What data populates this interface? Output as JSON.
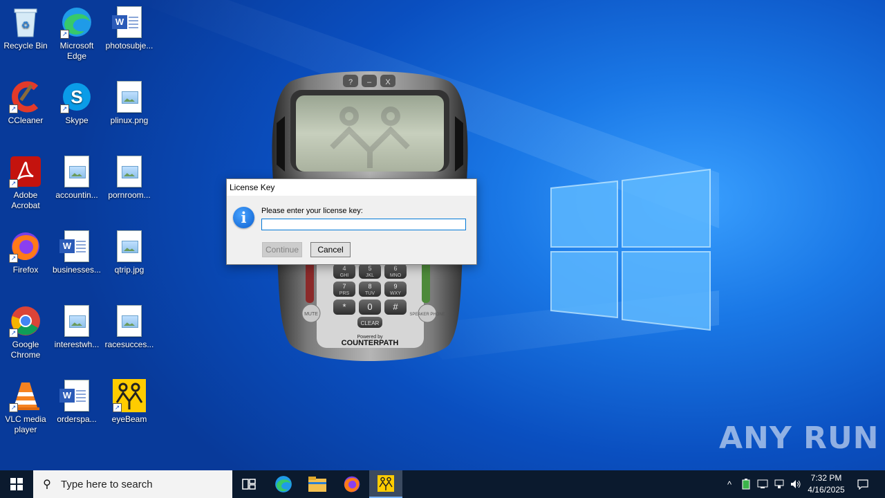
{
  "desktop": {
    "icons": [
      {
        "label": "Recycle Bin"
      },
      {
        "label": "Microsoft Edge"
      },
      {
        "label": "photosubje..."
      },
      {
        "label": "CCleaner"
      },
      {
        "label": "Skype"
      },
      {
        "label": "plinux.png"
      },
      {
        "label": "Adobe Acrobat"
      },
      {
        "label": "accountin..."
      },
      {
        "label": "pornroom..."
      },
      {
        "label": "Firefox"
      },
      {
        "label": "businesses..."
      },
      {
        "label": "qtrip.jpg"
      },
      {
        "label": "Google Chrome"
      },
      {
        "label": "interestwh..."
      },
      {
        "label": "racesucces..."
      },
      {
        "label": "VLC media player"
      },
      {
        "label": "orderspa..."
      },
      {
        "label": "eyeBeam"
      }
    ]
  },
  "phone": {
    "keys": [
      {
        "num": "4",
        "letters": "GHI"
      },
      {
        "num": "5",
        "letters": "JKL"
      },
      {
        "num": "6",
        "letters": "MNO"
      },
      {
        "num": "7",
        "letters": "PRS"
      },
      {
        "num": "8",
        "letters": "TUV"
      },
      {
        "num": "9",
        "letters": "WXY"
      },
      {
        "num": "*",
        "letters": ""
      },
      {
        "num": "0",
        "letters": ""
      },
      {
        "num": "#",
        "letters": ""
      }
    ],
    "clear_label": "CLEAR",
    "mute_label": "MUTE",
    "speaker_label": "SPEAKER PHONE",
    "powered_by": "Powered by",
    "brand": "COUNTERPATH",
    "top_buttons": [
      "?",
      "–",
      "X"
    ]
  },
  "dialog": {
    "title": "License Key",
    "prompt": "Please enter your license key:",
    "input_value": "",
    "continue_label": "Continue",
    "cancel_label": "Cancel"
  },
  "taskbar": {
    "search_placeholder": "Type here to search",
    "time": "7:32 PM",
    "date": "4/16/2025"
  },
  "watermark": "ANY RUN",
  "colors": {
    "desktop_blue": "#0a4fc0",
    "taskbar": "#0b1a2e",
    "accent": "#0078d7"
  }
}
